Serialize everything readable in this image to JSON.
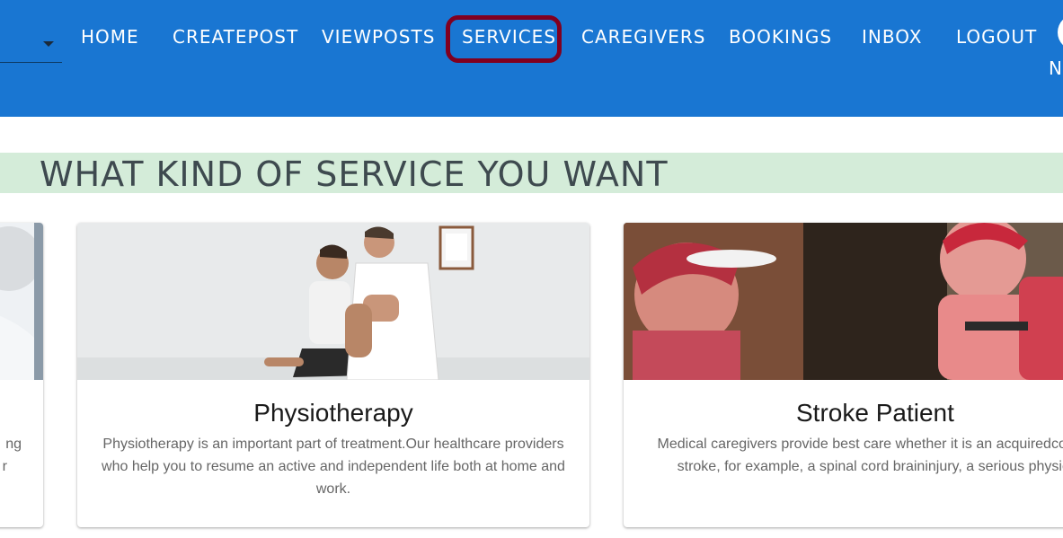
{
  "nav": {
    "links": [
      "HOME",
      "CREATEPOST",
      "VIEWPOSTS",
      "SERVICES",
      "CAREGIVERS",
      "BOOKINGS",
      "INBOX",
      "LOGOUT"
    ],
    "active": "SERVICES",
    "user_initial": "N"
  },
  "section": {
    "title": "WHAT KIND OF SERVICE YOU WANT"
  },
  "cards": [
    {
      "title": "",
      "text_fragments": [
        "ng",
        "r"
      ]
    },
    {
      "title": "Physiotherapy",
      "text": "Physiotherapy is an important part of treatment.Our healthcare providers who help you to resume an active and independent life both at home and work."
    },
    {
      "title": "Stroke Patient",
      "text": "Medical caregivers provide best care whether it is an acquiredcondition after stroke, for example, a spinal cord braininjury, a serious physical injury."
    }
  ],
  "colors": {
    "navbar": "#1976d2",
    "highlight": "#800020",
    "section_band": "#d4ecd9",
    "section_title": "#3e4a4f"
  }
}
